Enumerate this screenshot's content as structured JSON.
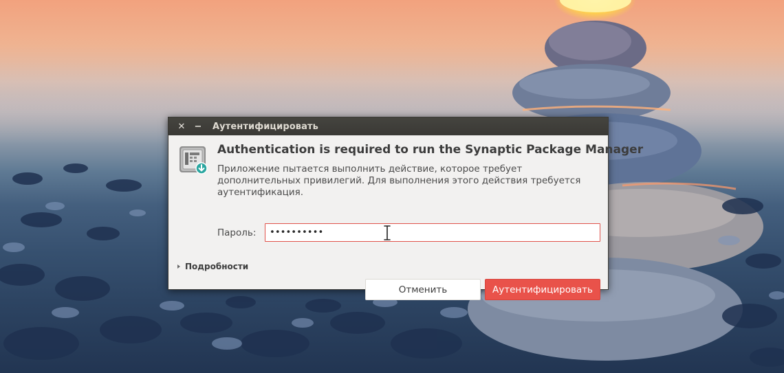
{
  "window": {
    "title": "Аутентифицировать",
    "close_glyph": "✕",
    "minimize_glyph": "−"
  },
  "dialog": {
    "icon": "synaptic-package-manager-icon",
    "heading": "Authentication is required to run the Synaptic Package Manager",
    "description": "Приложение пытается выполнить действие, которое требует дополнительных привилегий. Для выполнения этого действия требуется аутентификация.",
    "password_label": "Пароль:",
    "password_value": "••••••••••",
    "details_label": "Подробности",
    "cancel_label": "Отменить",
    "authenticate_label": "Аутентифицировать"
  },
  "colors": {
    "accent": "#e9524a",
    "titlebar": "#3c3b37",
    "dialog_bg": "#f2f1f0"
  }
}
